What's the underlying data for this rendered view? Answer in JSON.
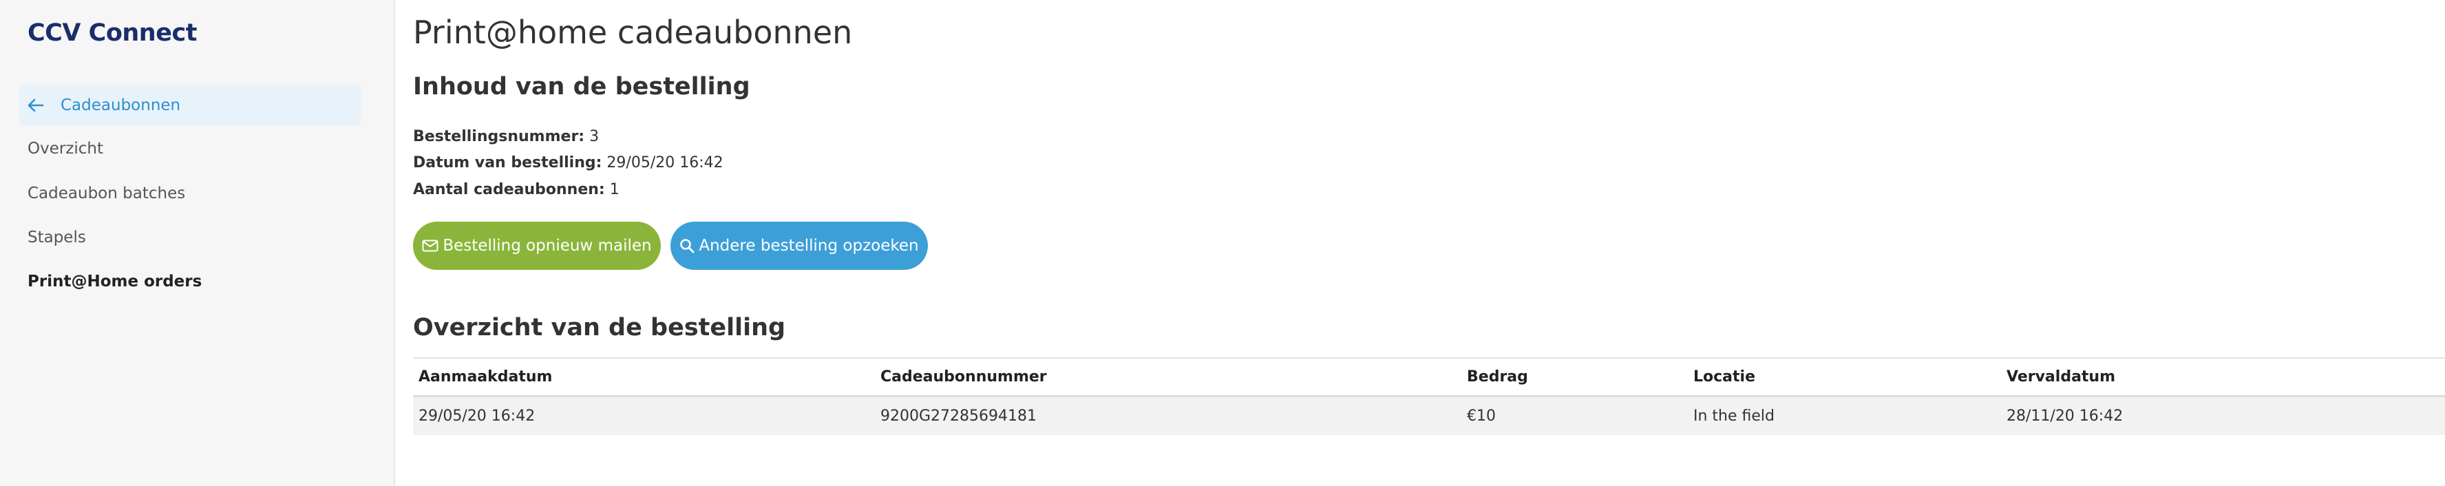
{
  "app": {
    "brand": "CCV Connect"
  },
  "sidebar": {
    "back_label": "Cadeaubonnen",
    "items": [
      {
        "label": "Overzicht"
      },
      {
        "label": "Cadeaubon batches"
      },
      {
        "label": "Stapels"
      },
      {
        "label": "Print@Home orders",
        "active": true
      }
    ]
  },
  "main": {
    "title": "Print@home cadeaubonnen",
    "content_heading": "Inhoud van de bestelling",
    "info": {
      "order_number_label": "Bestellingsnummer:",
      "order_number": "3",
      "order_date_label": "Datum van bestelling:",
      "order_date": "29/05/20 16:42",
      "voucher_count_label": "Aantal cadeaubonnen:",
      "voucher_count": "1"
    },
    "buttons": {
      "resend": "Bestelling opnieuw mailen",
      "lookup": "Andere bestelling opzoeken"
    },
    "overview_heading": "Overzicht van de bestelling",
    "table": {
      "columns": [
        "Aanmaakdatum",
        "Cadeaubonnummer",
        "Bedrag",
        "Locatie",
        "Vervaldatum"
      ],
      "rows": [
        [
          "29/05/20 16:42",
          "9200G27285694181",
          "€10",
          "In the field",
          "28/11/20 16:42"
        ]
      ]
    }
  },
  "colors": {
    "brand": "#1b2d6b",
    "accent": "#2d8fd0",
    "green_button": "#8bb53a",
    "blue_button": "#3d9fd8"
  },
  "icons": {
    "back": "arrow-left-icon",
    "resend": "envelope-icon",
    "lookup": "search-icon"
  }
}
